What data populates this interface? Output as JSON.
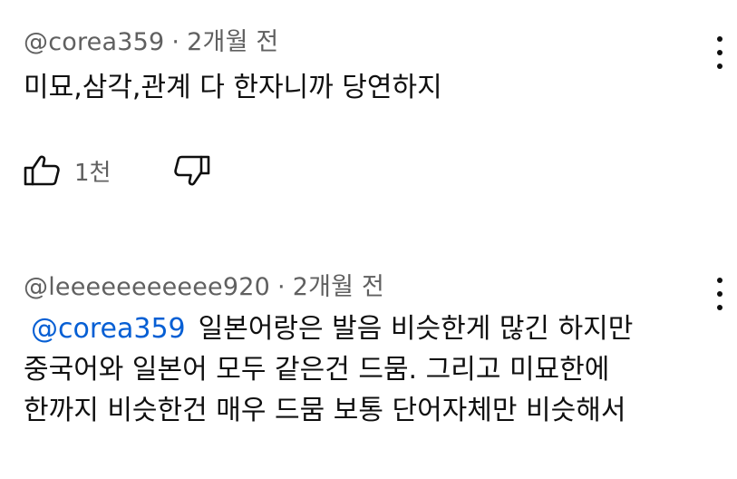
{
  "comments": [
    {
      "author": "@corea359",
      "separator": "·",
      "time": "2개월 전",
      "text_lines": [
        "미묘,삼각,관계 다 한자니까 당연하지"
      ],
      "like_count": "1천",
      "icons": {
        "like": "thumbs-up-icon",
        "dislike": "thumbs-down-icon",
        "menu": "more-vert-icon"
      }
    },
    {
      "author": "@leeeeeeeeeee920",
      "separator": "·",
      "time": "2개월 전",
      "mention": "@corea359",
      "text_lines": [
        "일본어랑은 발음 비슷한게 많긴 하지만",
        "중국어와 일본어 모두 같은건 드뭄. 그리고 미묘한에",
        "한까지 비슷한건 매우 드뭄 보통 단어자체만 비슷해서"
      ],
      "icons": {
        "menu": "more-vert-icon"
      }
    }
  ],
  "colors": {
    "text_primary": "#0f0f0f",
    "text_secondary": "#606060",
    "mention": "#065fd4",
    "background": "#ffffff"
  }
}
